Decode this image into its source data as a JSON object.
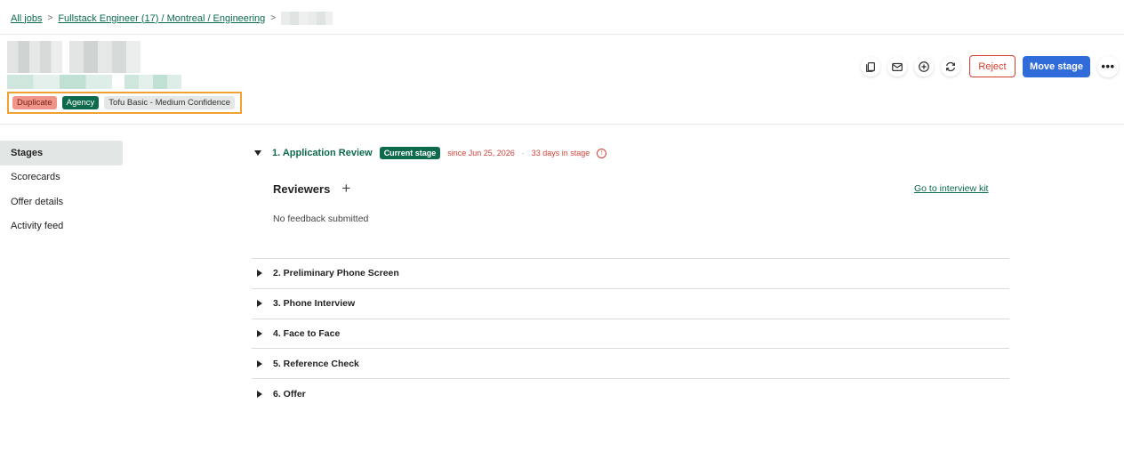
{
  "breadcrumb": {
    "all_jobs": "All jobs",
    "job": "Fullstack Engineer (17) / Montreal / Engineering"
  },
  "tags": [
    {
      "label": "Duplicate",
      "color": "#f0958a"
    },
    {
      "label": "Agency",
      "color": "#0e6a4c"
    },
    {
      "label": "Tofu Basic - Medium Confidence",
      "color": "#e4e7e6"
    }
  ],
  "actions": {
    "icons": [
      "copy-icon",
      "mail-icon",
      "add-circle-icon",
      "refresh-icon"
    ],
    "reject_label": "Reject",
    "move_stage_label": "Move stage",
    "more_label": "•••"
  },
  "sidebar": {
    "items": [
      {
        "label": "Stages",
        "active": true
      },
      {
        "label": "Scorecards",
        "active": false
      },
      {
        "label": "Offer details",
        "active": false
      },
      {
        "label": "Activity feed",
        "active": false
      }
    ]
  },
  "current_stage": {
    "title": "1. Application Review",
    "badge": "Current stage",
    "since": "since Jun 25, 2026",
    "separator": "·",
    "days": "33 days in stage",
    "info_glyph": "!"
  },
  "reviewers": {
    "title": "Reviewers",
    "add_glyph": "+",
    "interview_kit_link": "Go to interview kit",
    "no_feedback": "No feedback submitted"
  },
  "stages": [
    "2. Preliminary Phone Screen",
    "3. Phone Interview",
    "4. Face to Face",
    "5. Reference Check",
    "6. Offer"
  ],
  "colors": {
    "accent_green": "#0e6a4c",
    "primary_blue": "#2f6bd9",
    "danger_red": "#d63b2e",
    "highlight_orange": "#f0a131"
  }
}
